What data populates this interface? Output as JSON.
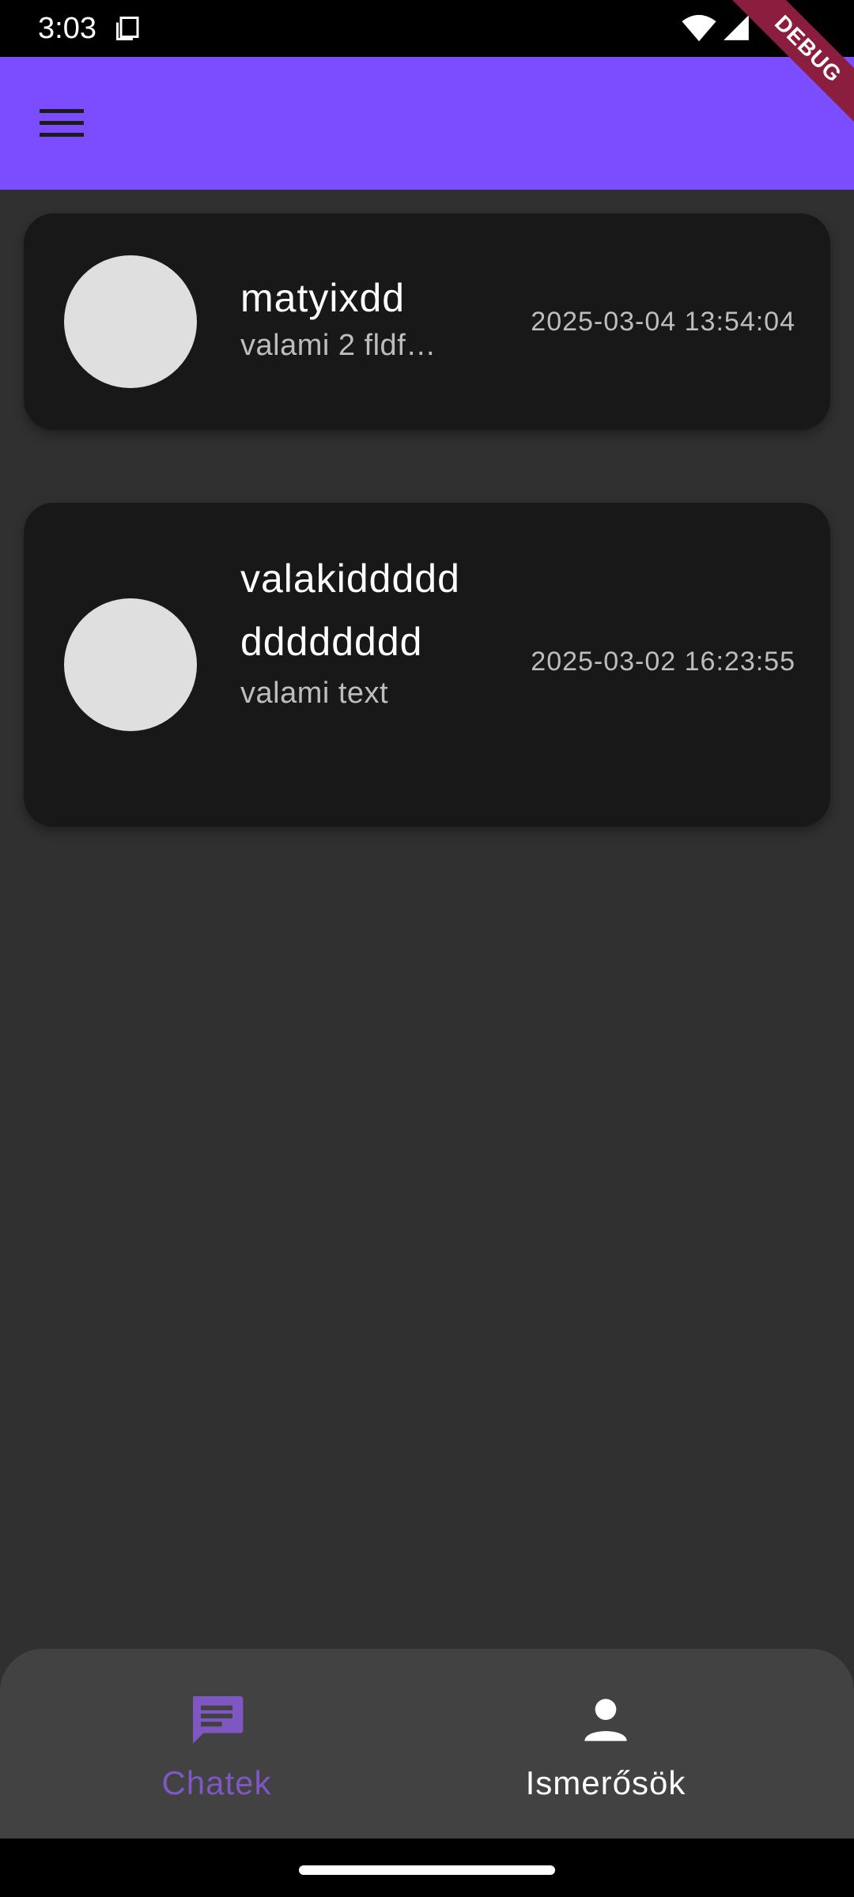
{
  "status_bar": {
    "time": "3:03"
  },
  "debug_banner": {
    "label": "DEBUG"
  },
  "chats": [
    {
      "name": "matyixdd",
      "preview": "valami 2 fldf…",
      "timestamp": "2025-03-04 13:54:04"
    },
    {
      "name": "valakiddddddddddddd",
      "preview": "valami text",
      "timestamp": "2025-03-02 16:23:55"
    }
  ],
  "bottom_nav": {
    "items": [
      {
        "label": "Chatek",
        "icon": "chat-icon",
        "active": true
      },
      {
        "label": "Ismerősök",
        "icon": "person-icon",
        "active": false
      }
    ]
  },
  "colors": {
    "app_bar": "#7c4dff",
    "background": "#303030",
    "card": "#181818",
    "nav_active": "#7e57c2"
  }
}
